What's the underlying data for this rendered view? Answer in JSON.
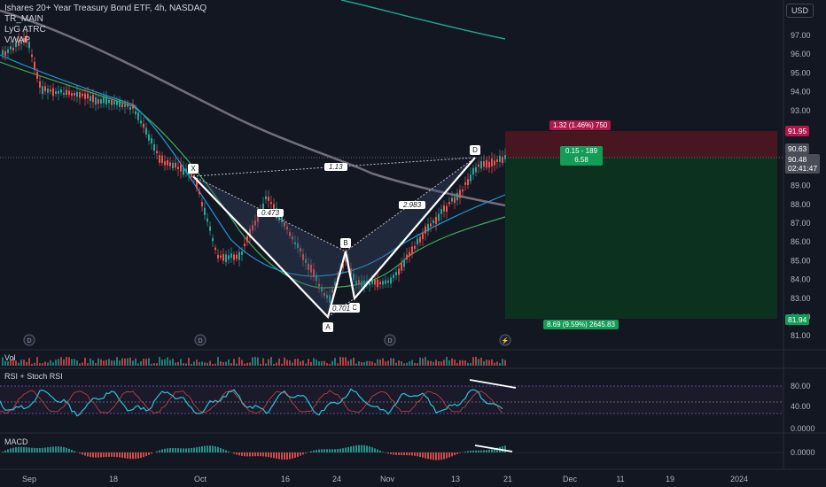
{
  "legend": {
    "title": "Ishares 20+ Year Treasury Bond ETF, 4h, NASDAQ",
    "ind1": "TR_MAIN",
    "ind2": "LyG ATRC",
    "ind3": "VWAP"
  },
  "currency": "USD",
  "price_axis": [
    "97.00",
    "96.00",
    "95.00",
    "94.00",
    "93.00",
    "90.00",
    "89.00",
    "88.00",
    "87.00",
    "86.00",
    "85.00",
    "84.00",
    "83.00",
    "82.00",
    "81.00"
  ],
  "price_tags": {
    "stop": "91.95",
    "last": "90.63",
    "current": "90.48",
    "countdown": "02:41:47",
    "target": "81.94"
  },
  "trade": {
    "stop_label": "1.32 (1.46%) 750",
    "mid_label_1": "0.15 - 189",
    "mid_label_2": "6.58",
    "target_label": "8.69 (9.59%) 2645.83"
  },
  "pattern": {
    "x": "X",
    "a": "A",
    "b": "B",
    "c": "C",
    "d": "D",
    "xb_ratio": "1.13",
    "xa_ratio": "0.473",
    "bc_ratio": "0.701",
    "cd_ratio": "2.983"
  },
  "panes": {
    "vol": "Vol",
    "rsi": "RSI + Stoch RSI",
    "macd": "MACD"
  },
  "rsi_axis": [
    "80.00",
    "40.00",
    "0.0000"
  ],
  "macd_axis": [
    "0.0000"
  ],
  "time_axis": [
    "Sep",
    "18",
    "Oct",
    "16",
    "24",
    "Nov",
    "13",
    "21",
    "Dec",
    "11",
    "19",
    "2024"
  ],
  "colors": {
    "bg": "#131722",
    "bull": "#26a69a",
    "bear": "#ef5350",
    "stop_zone": "#5b1a28",
    "target_zone": "#0f3a22"
  }
}
